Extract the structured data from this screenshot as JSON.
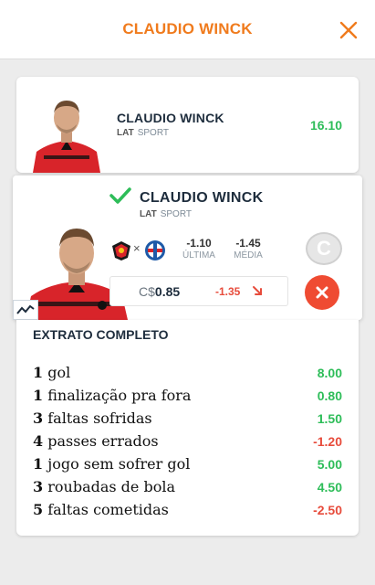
{
  "header": {
    "title": "CLAUDIO WINCK"
  },
  "colors": {
    "accent": "#f07b1d",
    "positive": "#2ebd59",
    "negative": "#e74c3c",
    "dark": "#1e2d3d"
  },
  "summary_card": {
    "name": "CLAUDIO WINCK",
    "position": "LAT",
    "club": "SPORT",
    "points": "16.10"
  },
  "detail_card": {
    "name": "CLAUDIO WINCK",
    "position": "LAT",
    "club": "SPORT",
    "match_separator": "×",
    "last_value": "-1.10",
    "last_label": "ÚLTIMA",
    "avg_value": "-1.45",
    "avg_label": "MÉDIA",
    "coin_letter": "C",
    "price_currency": "C$",
    "price_value": "0.85",
    "variation": "-1.35"
  },
  "extrato": {
    "heading": "EXTRATO COMPLETO",
    "items": [
      {
        "count": "1",
        "label": "gol",
        "points": "8.00",
        "sign": "pos"
      },
      {
        "count": "1",
        "label": "finalização pra fora",
        "points": "0.80",
        "sign": "pos"
      },
      {
        "count": "3",
        "label": "faltas sofridas",
        "points": "1.50",
        "sign": "pos"
      },
      {
        "count": "4",
        "label": "passes errados",
        "points": "-1.20",
        "sign": "neg"
      },
      {
        "count": "1",
        "label": "jogo sem sofrer gol",
        "points": "5.00",
        "sign": "pos"
      },
      {
        "count": "3",
        "label": "roubadas de bola",
        "points": "4.50",
        "sign": "pos"
      },
      {
        "count": "5",
        "label": "faltas cometidas",
        "points": "-2.50",
        "sign": "neg"
      }
    ]
  },
  "icons": [
    "close-icon",
    "check-icon",
    "trend-icon",
    "sport-crest-icon",
    "bahia-crest-icon",
    "arrow-down-right-icon",
    "x-icon"
  ]
}
